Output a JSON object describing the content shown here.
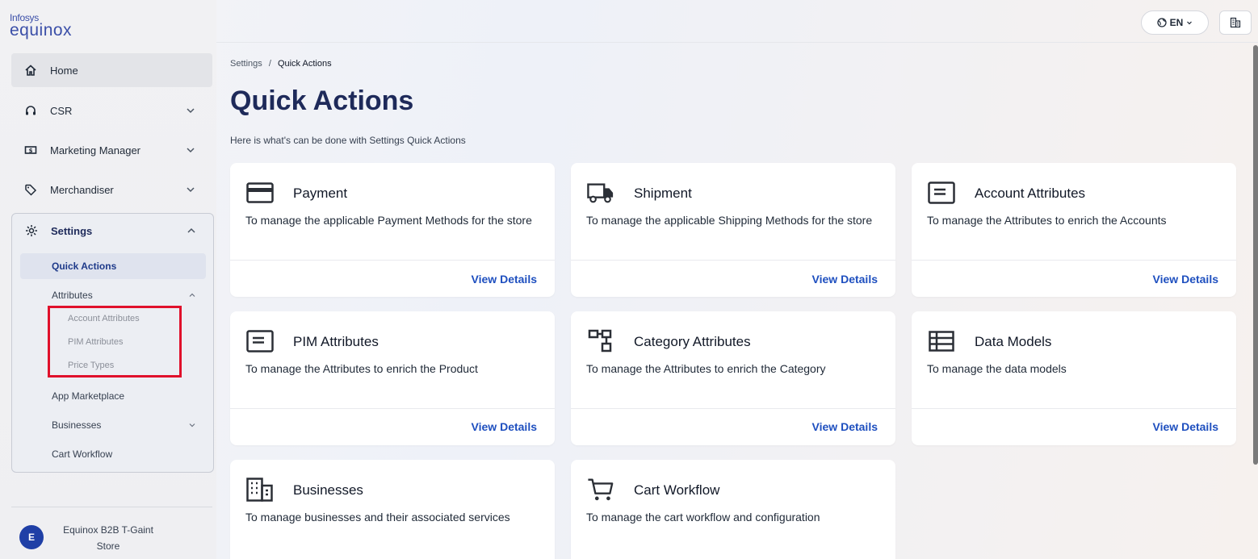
{
  "brand": {
    "line1": "Infosys",
    "line2": "equinox"
  },
  "nav": {
    "home": "Home",
    "csr": "CSR",
    "marketing": "Marketing Manager",
    "merch": "Merchandiser",
    "settings": "Settings",
    "sub": {
      "quick_actions": "Quick Actions",
      "attributes": "Attributes",
      "account_attributes": "Account Attributes",
      "pim_attributes": "PIM Attributes",
      "price_types": "Price Types",
      "app_marketplace": "App Marketplace",
      "businesses": "Businesses",
      "cart_workflow": "Cart Workflow"
    }
  },
  "profile": {
    "initial": "E",
    "name": "Equinox B2B T-Gaint Store"
  },
  "topbar": {
    "lang": "EN"
  },
  "breadcrumb": {
    "parent": "Settings",
    "sep": "/",
    "current": "Quick Actions"
  },
  "page": {
    "title": "Quick Actions",
    "subtitle": "Here is what's can be done with Settings Quick Actions"
  },
  "link_label": "View Details",
  "cards": [
    {
      "title": "Payment",
      "desc": "To manage the applicable Payment Methods for the store",
      "icon": "credit-card-icon"
    },
    {
      "title": "Shipment",
      "desc": "To manage the applicable Shipping Methods for the store",
      "icon": "truck-icon"
    },
    {
      "title": "Account Attributes",
      "desc": "To manage the Attributes to enrich the Accounts",
      "icon": "list-box-icon"
    },
    {
      "title": "PIM Attributes",
      "desc": "To manage the Attributes to enrich the Product",
      "icon": "list-box-icon"
    },
    {
      "title": "Category Attributes",
      "desc": "To manage the Attributes to enrich the Category",
      "icon": "hierarchy-icon"
    },
    {
      "title": "Data Models",
      "desc": "To manage the data models",
      "icon": "table-icon"
    },
    {
      "title": "Businesses",
      "desc": "To manage businesses and their associated services",
      "icon": "building-icon"
    },
    {
      "title": "Cart Workflow",
      "desc": "To manage the cart workflow and configuration",
      "icon": "cart-icon"
    }
  ],
  "colors": {
    "accent": "#1e4fbf",
    "title": "#1e2a5a",
    "highlight": "#e0102b"
  }
}
